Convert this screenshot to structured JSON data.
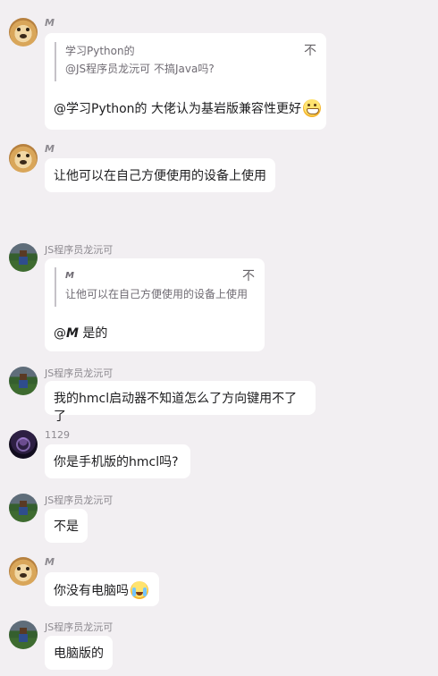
{
  "messages": [
    {
      "sender": "M",
      "quote": {
        "author": "学习Python的",
        "text": "@JS程序员龙沅可 不搞Java吗?",
        "close": "不"
      },
      "text": "@学习Python的 大佬认为基岩版兼容性更好",
      "emoji": "grinning-face-emoji"
    },
    {
      "sender": "M",
      "text": "让他可以在自己方便使用的设备上使用"
    },
    {
      "sender": "JS程序员龙沅可",
      "quote": {
        "author": "M",
        "text": "让他可以在自己方便使用的设备上使用",
        "close": "不"
      },
      "text_prefix": "@",
      "mention": "M",
      "text_suffix": " 是的"
    },
    {
      "sender": "JS程序员龙沅可",
      "text": "我的hmcl启动器不知道怎么了方向键用不了了"
    },
    {
      "sender": "1129",
      "text": "你是手机版的hmcl吗?"
    },
    {
      "sender": "JS程序员龙沅可",
      "text": "不是"
    },
    {
      "sender": "M",
      "text": "你没有电脑吗",
      "emoji": "crying-face-emoji"
    },
    {
      "sender": "JS程序员龙沅可",
      "text": "电脑版的"
    }
  ]
}
